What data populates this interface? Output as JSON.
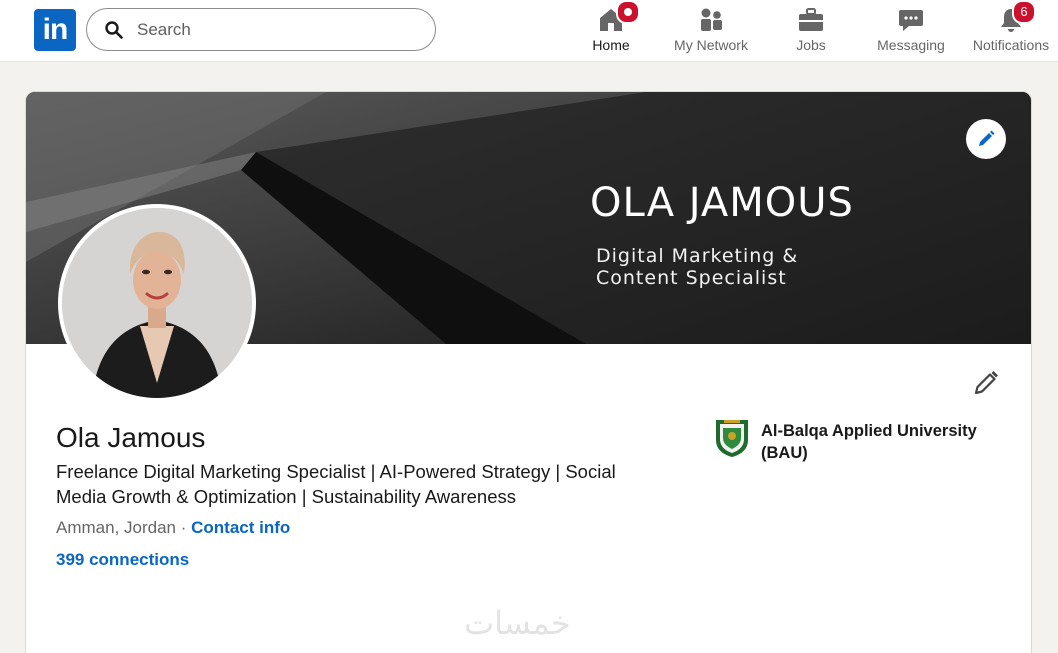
{
  "nav": {
    "search_placeholder": "Search",
    "items": [
      {
        "label": "Home",
        "icon": "home-icon"
      },
      {
        "label": "My Network",
        "icon": "network-icon"
      },
      {
        "label": "Jobs",
        "icon": "briefcase-icon"
      },
      {
        "label": "Messaging",
        "icon": "chat-icon"
      },
      {
        "label": "Notifications",
        "icon": "bell-icon"
      }
    ],
    "notifications_count": "6"
  },
  "banner": {
    "title": "OLA JAMOUS",
    "subtitle_line1": "Digital Marketing &",
    "subtitle_line2": "Content Specialist"
  },
  "profile": {
    "name": "Ola Jamous",
    "headline": "Freelance Digital Marketing Specialist | AI-Powered Strategy | Social Media Growth & Optimization | Sustainability Awareness",
    "location": "Amman, Jordan",
    "separator": " · ",
    "contact_label": "Contact info",
    "connections": "399 connections"
  },
  "education": {
    "school": "Al-Balqa Applied University (BAU)"
  },
  "watermark": "خمسات",
  "colors": {
    "brand": "#0a66c2",
    "badge": "#cb112d",
    "page_bg": "#f4f2ee"
  }
}
